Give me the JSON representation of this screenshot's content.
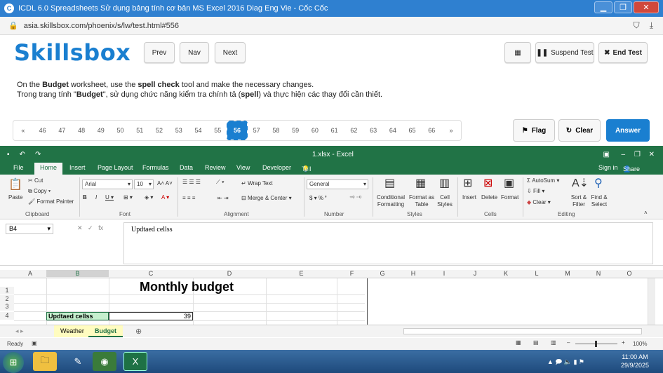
{
  "browser": {
    "title": "ICDL 6.0 Spreadsheets Sử dụng bảng tính cơ bản MS Excel 2016 Diag Eng Vie - Cốc Cốc",
    "url": "asia.skillsbox.com/phoenix/s/lw/test.html#556"
  },
  "skillsbox": {
    "logo": "Skillsbox",
    "prev": "Prev",
    "nav": "Nav",
    "next": "Next",
    "suspend": "Suspend Test",
    "end": "End Test",
    "instr_en_1": "On the ",
    "instr_en_sheet": "Budget",
    "instr_en_2": " worksheet, use the ",
    "instr_en_tool": "spell check",
    "instr_en_3": " tool and make the necessary changes.",
    "instr_vi_1": "Trong trang tính \"",
    "instr_vi_sheet": "Budget",
    "instr_vi_2": "\", sử dụng chức năng kiểm tra chính tả (",
    "instr_vi_tool": "spell",
    "instr_vi_3": ") và thực hiện các thay đổi cần thiết.",
    "questions": [
      "«",
      "46",
      "47",
      "48",
      "49",
      "50",
      "51",
      "52",
      "53",
      "54",
      "55",
      "56",
      "57",
      "58",
      "59",
      "60",
      "61",
      "62",
      "63",
      "64",
      "65",
      "66",
      "»"
    ],
    "active_question": "56",
    "flag": "Flag",
    "clear": "Clear",
    "answer": "Answer"
  },
  "excel": {
    "file_title": "1.xlsx - Excel",
    "tabs": [
      "File",
      "Home",
      "Insert",
      "Page Layout",
      "Formulas",
      "Data",
      "Review",
      "View",
      "Developer"
    ],
    "tell_me": "Tell me what you want to do...",
    "signin": "Sign in",
    "share": "Share",
    "ribbon": {
      "paste": "Paste",
      "cut": "Cut",
      "copy": "Copy",
      "format_painter": "Format Painter",
      "clipboard": "Clipboard",
      "font_name": "Arial",
      "font_size": "10",
      "font": "Font",
      "wrap_text": "Wrap Text",
      "merge_center": "Merge & Center",
      "alignment": "Alignment",
      "number_format": "General",
      "number": "Number",
      "conditional_formatting": "Conditional Formatting",
      "format_as_table": "Format as Table",
      "cell_styles": "Cell Styles",
      "styles": "Styles",
      "insert": "Insert",
      "delete": "Delete",
      "format": "Format",
      "cells": "Cells",
      "autosum": "AutoSum",
      "fill": "Fill",
      "clear": "Clear",
      "sort_filter": "Sort & Filter",
      "find_select": "Find & Select",
      "editing": "Editing"
    },
    "name_box": "B4",
    "formula_value": "Updtaed cellss",
    "columns": [
      "A",
      "B",
      "C",
      "D",
      "E",
      "F",
      "G",
      "H",
      "I",
      "J",
      "K",
      "L",
      "M",
      "N",
      "O"
    ],
    "rows": [
      "1",
      "2",
      "3",
      "4"
    ],
    "title_cell": "Monthly budget",
    "b4": "Updtaed cellss",
    "c4": "39",
    "sheets": [
      "Weather",
      "Budget"
    ],
    "status": "Ready",
    "zoom": "100%"
  },
  "taskbar": {
    "time": "11:00 AM",
    "date": "29/9/2025"
  }
}
